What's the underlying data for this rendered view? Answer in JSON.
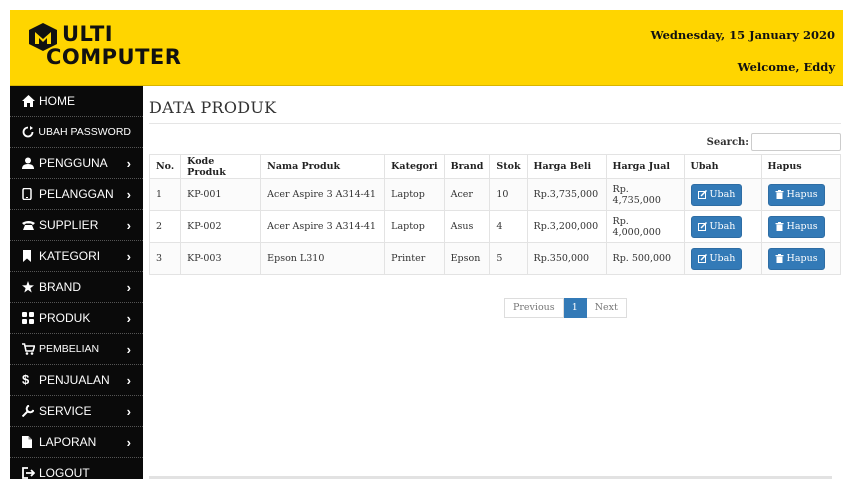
{
  "app": {
    "logo_line1": "ULTI",
    "logo_line2": "COMPUTER",
    "date": "Wednesday, 15 January 2020",
    "welcome": "Welcome, Eddy"
  },
  "sidebar": {
    "items": [
      {
        "label": "HOME",
        "icon": "home-icon"
      },
      {
        "label": "UBAH PASSWORD",
        "icon": "refresh-icon"
      },
      {
        "label": "PENGGUNA",
        "icon": "user-icon"
      },
      {
        "label": "PELANGGAN",
        "icon": "phone-icon"
      },
      {
        "label": "SUPPLIER",
        "icon": "telephone-icon"
      },
      {
        "label": "KATEGORI",
        "icon": "bookmark-icon"
      },
      {
        "label": "BRAND",
        "icon": "star-icon"
      },
      {
        "label": "PRODUK",
        "icon": "grid-icon"
      },
      {
        "label": "PEMBELIAN",
        "icon": "cart-icon"
      },
      {
        "label": "PENJUALAN",
        "icon": "dollar-icon"
      },
      {
        "label": "SERVICE",
        "icon": "wrench-icon"
      },
      {
        "label": "LAPORAN",
        "icon": "document-icon"
      },
      {
        "label": "LOGOUT",
        "icon": "logout-icon"
      }
    ]
  },
  "main": {
    "title": "DATA PRODUK",
    "search_label": "Search:",
    "columns": [
      "No.",
      "Kode Produk",
      "Nama Produk",
      "Kategori",
      "Brand",
      "Stok",
      "Harga Beli",
      "Harga Jual",
      "Ubah",
      "Hapus"
    ],
    "rows": [
      {
        "no": "1",
        "kode": "KP-001",
        "nama": "Acer Aspire 3 A314-41",
        "kategori": "Laptop",
        "brand": "Acer",
        "stok": "10",
        "beli": "Rp.3,735,000",
        "jual": "Rp. 4,735,000",
        "ubah": "Ubah",
        "hapus": "Hapus"
      },
      {
        "no": "2",
        "kode": "KP-002",
        "nama": "Acer Aspire 3 A314-41",
        "kategori": "Laptop",
        "brand": "Asus",
        "stok": "4",
        "beli": "Rp.3,200,000",
        "jual": "Rp. 4,000,000",
        "ubah": "Ubah",
        "hapus": "Hapus"
      },
      {
        "no": "3",
        "kode": "KP-003",
        "nama": "Epson L310",
        "kategori": "Printer",
        "brand": "Epson",
        "stok": "5",
        "beli": "Rp.350,000",
        "jual": "Rp. 500,000",
        "ubah": "Ubah",
        "hapus": "Hapus"
      }
    ],
    "pager": {
      "previous": "Previous",
      "page": "1",
      "next": "Next"
    }
  },
  "colors": {
    "header": "#ffd500",
    "sidebar": "#0a0a0a",
    "button": "#337ab7"
  }
}
